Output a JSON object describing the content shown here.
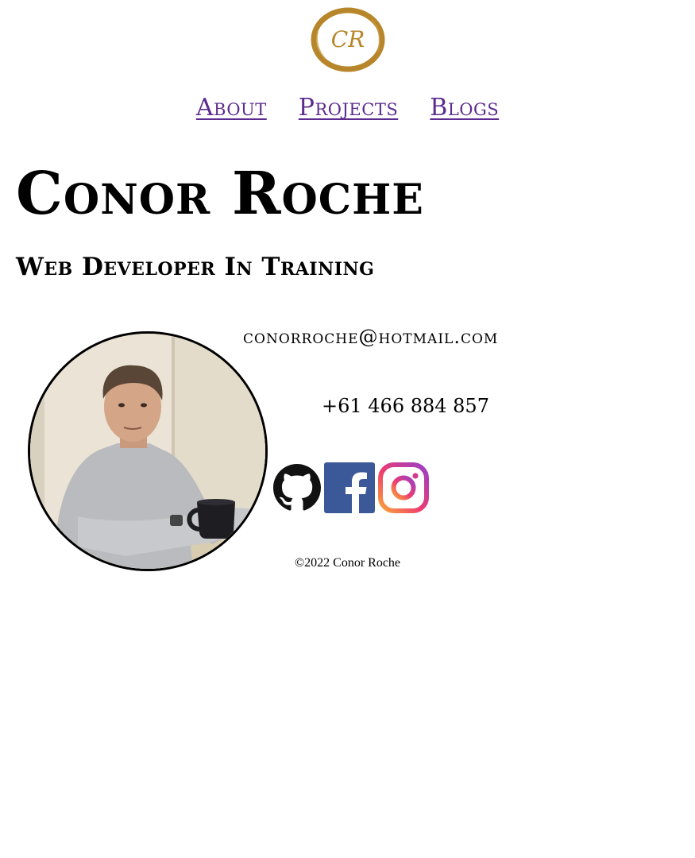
{
  "logo": {
    "text": "CR",
    "icon": "cr-monogram-logo-icon",
    "color": "#b8862a"
  },
  "nav": {
    "items": [
      {
        "label": "About"
      },
      {
        "label": "Projects"
      },
      {
        "label": "Blogs"
      }
    ],
    "link_color": "#5b2b8f"
  },
  "hero": {
    "name": "Conor Roche",
    "subtitle": "Web Developer In Training"
  },
  "profile": {
    "image_description": "profile-photo"
  },
  "contact": {
    "email": "conorroche@hotmail.com",
    "phone": "+61 466 884 857"
  },
  "socials": [
    {
      "icon": "github-icon"
    },
    {
      "icon": "facebook-icon",
      "color": "#3b5998"
    },
    {
      "icon": "instagram-icon"
    }
  ],
  "footer": {
    "text": "©2022 Conor Roche"
  }
}
